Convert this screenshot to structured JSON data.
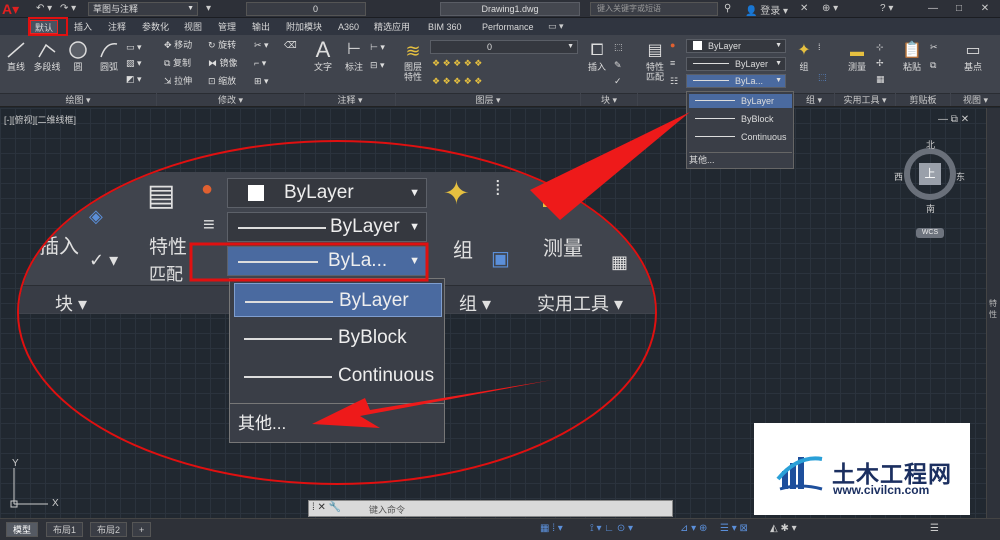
{
  "titlebar": {
    "workspace": "草图与注释",
    "layer_value": "0",
    "document": "Drawing1.dwg",
    "search_placeholder": "键入关键字或短语",
    "login": "登录"
  },
  "tabs": [
    "默认",
    "插入",
    "注释",
    "参数化",
    "视图",
    "管理",
    "输出",
    "附加模块",
    "A360",
    "精选应用",
    "BIM 360",
    "Performance"
  ],
  "ribbon": {
    "draw_tools": [
      "直线",
      "多段线",
      "圆",
      "圆弧"
    ],
    "modify_tools": [
      "移动",
      "旋转",
      "复制",
      "镜像",
      "拉伸",
      "缩放"
    ],
    "annot_tools": [
      "文字",
      "标注"
    ],
    "layer_props": "图层\n特性",
    "layer_combo": "0",
    "insert": "插入",
    "match_props": "特性\n匹配",
    "group": "组",
    "measure": "测量",
    "paste": "粘贴",
    "base": "基点",
    "prop_color": "ByLayer",
    "prop_linetype": "ByLayer",
    "prop_lineweight": "ByLa...",
    "panels": [
      "绘图",
      "修改",
      "注释",
      "图层",
      "块",
      "组",
      "实用工具",
      "剪贴板",
      "视图"
    ]
  },
  "lineweight_dropdown": {
    "items": [
      "ByLayer",
      "ByBlock",
      "Continuous"
    ],
    "selected": "ByLayer",
    "more": "其他..."
  },
  "viewport": {
    "label": "[-][俯视][二维线框]",
    "viewcube": {
      "top": "上",
      "north": "北",
      "south": "南",
      "east": "东",
      "west": "西",
      "wcs": "WCS"
    },
    "side_panel": "特性"
  },
  "zoom": {
    "insert": "插入",
    "match_props_1": "特性",
    "match_props_2": "匹配",
    "color": "ByLayer",
    "linetype": "ByLayer",
    "lineweight": "ByLa...",
    "group": "组",
    "measure": "测量",
    "footer_block": "块",
    "footer_group": "组",
    "footer_util": "实用工具",
    "dropdown_items": [
      "ByLayer",
      "ByBlock",
      "Continuous"
    ],
    "dropdown_more": "其他..."
  },
  "cmdline": {
    "placeholder": "键入命令"
  },
  "statusbar": {
    "tabs": [
      "模型",
      "布局1",
      "布局2"
    ],
    "active_tab": "模型"
  },
  "watermark": {
    "title": "土木工程网",
    "url": "www.civilcn.com"
  },
  "colors": {
    "highlight": "#e01010",
    "selection": "#4a6aa0",
    "ribbon": "#40444d"
  }
}
